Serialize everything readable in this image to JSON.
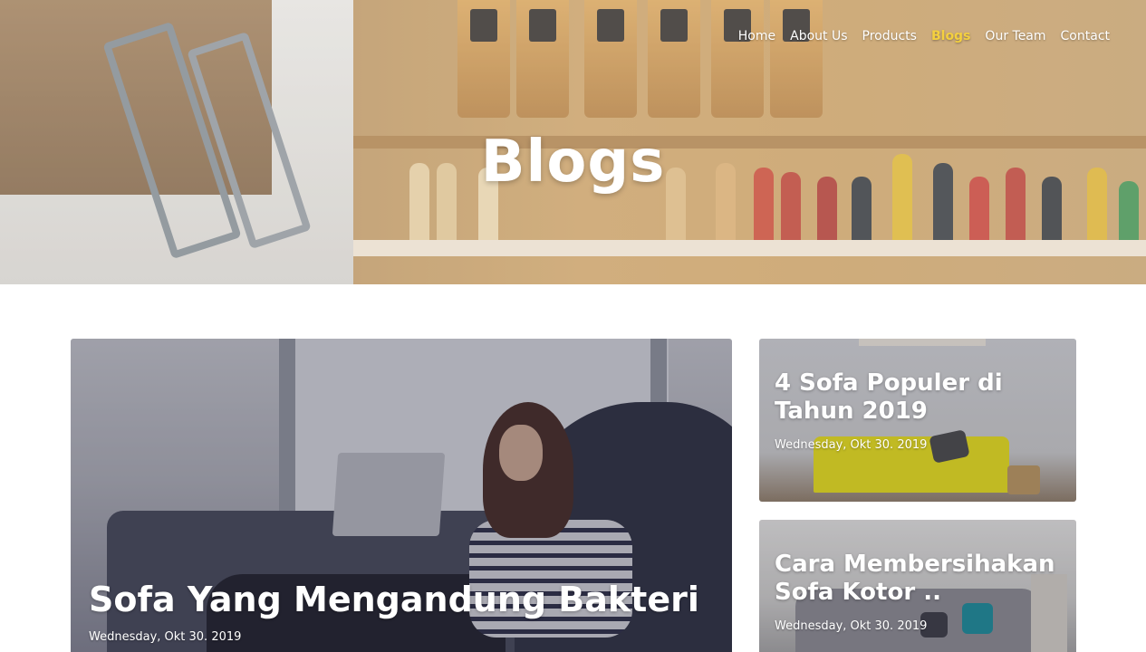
{
  "nav": {
    "items": [
      {
        "label": "Home",
        "active": false
      },
      {
        "label": "About Us",
        "active": false
      },
      {
        "label": "Products",
        "active": false
      },
      {
        "label": "Blogs",
        "active": true
      },
      {
        "label": "Our Team",
        "active": false
      },
      {
        "label": "Contact",
        "active": false
      }
    ],
    "active_color": "#f4d03f"
  },
  "hero": {
    "title": "Blogs"
  },
  "posts": {
    "featured": {
      "title": "Sofa Yang Mengandung Bakteri",
      "date": "Wednesday, Okt 30. 2019"
    },
    "side": [
      {
        "title": "4 Sofa Populer di Tahun 2019",
        "date": "Wednesday, Okt 30. 2019"
      },
      {
        "title": "Cara Membersihakan Sofa Kotor ..",
        "date": "Wednesday, Okt 30. 2019"
      }
    ]
  }
}
